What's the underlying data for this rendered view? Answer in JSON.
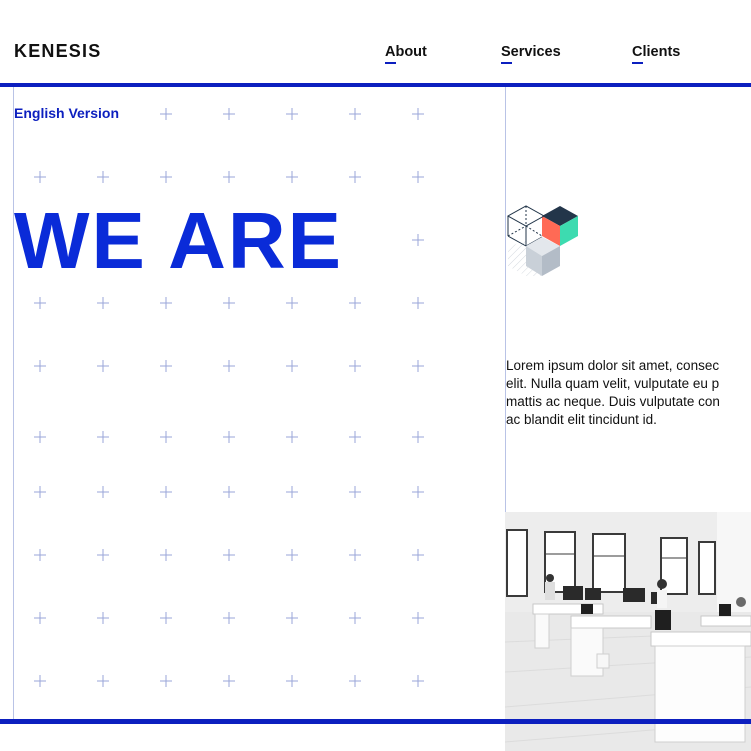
{
  "header": {
    "logo": "KENESIS",
    "nav": [
      {
        "label": "About"
      },
      {
        "label": "Services"
      },
      {
        "label": "Clients"
      }
    ]
  },
  "language_link": "English Version",
  "hero_text": "WE ARE",
  "body_text_lines": [
    "Lorem ipsum dolor sit amet, consec",
    "elit. Nulla quam velit, vulputate eu p",
    "mattis ac neque. Duis vulputate con",
    "ac blandit elit tincidunt id."
  ],
  "colors": {
    "accent": "#0c1fbf",
    "hero": "#0a2bd8",
    "cube_teal": "#3ddbb0",
    "cube_coral": "#ff6a55",
    "cube_navy": "#23364a",
    "cube_gray": "#c9d0d8"
  }
}
